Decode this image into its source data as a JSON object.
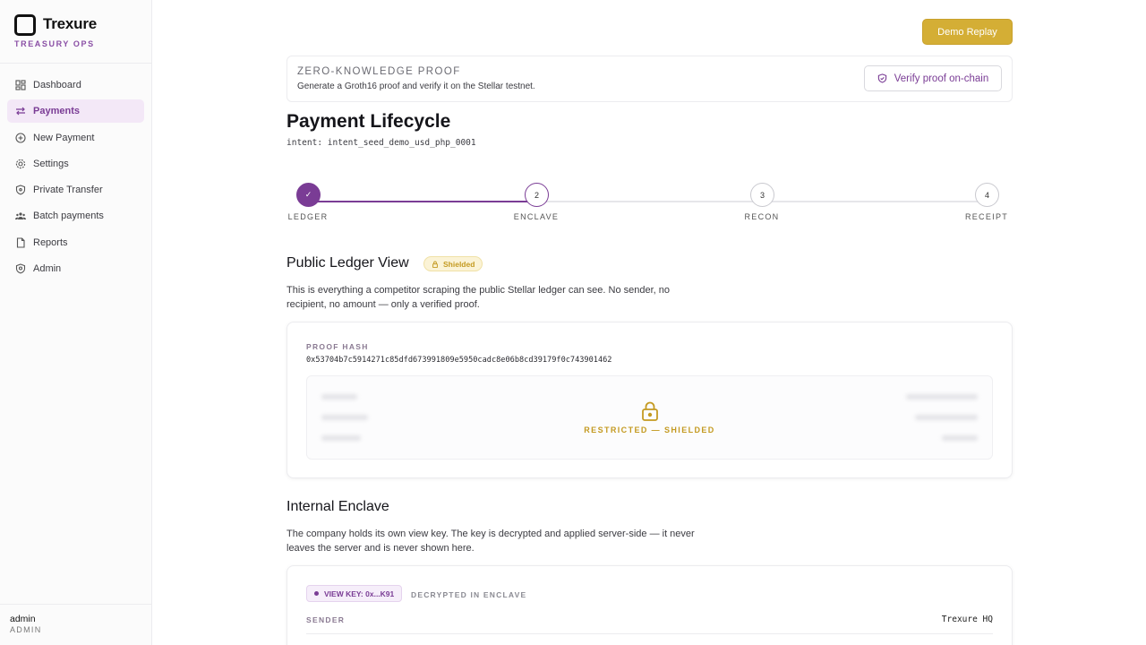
{
  "brand": {
    "name": "Trexure",
    "subtitle": "TREASURY OPS"
  },
  "sidebar": {
    "items": [
      {
        "label": "Dashboard",
        "icon": "grid-icon"
      },
      {
        "label": "Payments",
        "icon": "arrows-exchange-icon",
        "active": true
      },
      {
        "label": "New Payment",
        "icon": "plus-circle-icon"
      },
      {
        "label": "Settings",
        "icon": "gear-icon"
      },
      {
        "label": "Private Transfer",
        "icon": "shield-icon"
      },
      {
        "label": "Batch payments",
        "icon": "users-icon"
      },
      {
        "label": "Reports",
        "icon": "document-icon"
      },
      {
        "label": "Admin",
        "icon": "shield-check-icon"
      }
    ]
  },
  "user": {
    "name": "admin",
    "role": "ADMIN"
  },
  "header": {
    "demo_button": "Demo Replay"
  },
  "zk": {
    "title": "ZERO-KNOWLEDGE PROOF",
    "description": "Generate a Groth16 proof and verify it on the Stellar testnet.",
    "verify_button": "Verify proof on-chain"
  },
  "page": {
    "title": "Payment Lifecycle",
    "intent": "intent: intent_seed_demo_usd_php_0001"
  },
  "stepper": {
    "steps": [
      {
        "number": "✓",
        "label": "LEDGER",
        "state": "done"
      },
      {
        "number": "2",
        "label": "ENCLAVE",
        "state": "current"
      },
      {
        "number": "3",
        "label": "RECON",
        "state": "pending"
      },
      {
        "number": "4",
        "label": "RECEIPT",
        "state": "pending"
      }
    ]
  },
  "public_ledger": {
    "title": "Public Ledger View",
    "badge": "Shielded",
    "description": "This is everything a competitor scraping the public Stellar ledger can see. No sender, no recipient, no amount — only a verified proof.",
    "proof_hash_label": "PROOF HASH",
    "proof_hash": "0x53704b7c5914271c85dfd673991809e5950cadc8e06b8cd39179f0c743901462",
    "restricted_text": "RESTRICTED — SHIELDED"
  },
  "enclave": {
    "title": "Internal Enclave",
    "description": "The company holds its own view key. The key is decrypted and applied server-side — it never leaves the server and is never shown here.",
    "view_key": "VIEW KEY: 0x...K91",
    "decrypted_label": "DECRYPTED IN ENCLAVE",
    "rows": [
      {
        "label": "SENDER",
        "value": "Trexure HQ"
      }
    ]
  },
  "colors": {
    "accent": "#7a3c95",
    "gold": "#d4ae35",
    "shield": "#c49a21"
  }
}
